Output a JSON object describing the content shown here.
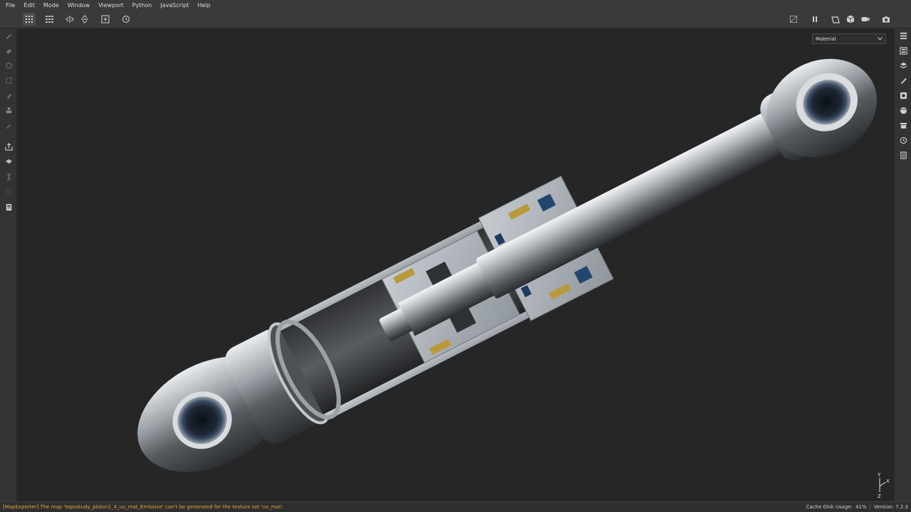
{
  "menu": [
    "File",
    "Edit",
    "Mode",
    "Window",
    "Viewport",
    "Python",
    "JavaScript",
    "Help"
  ],
  "viewport": {
    "display_mode": "Material"
  },
  "gizmo": {
    "y": "Y",
    "x": "X",
    "z": "Z"
  },
  "status": {
    "message": "[MapExporter] The map 'topostudy_piston1_4_uv_mat_Emissive' can't be generated for the texture set 'uv_mat'.",
    "cache_label": "Cache Disk Usage:",
    "cache_value": "41%",
    "separator": "|",
    "version": "Version: 7.2.3"
  },
  "colors": {
    "accent_status": "#e0a63a",
    "menubar_bg": "#3a3a3a",
    "viewport_bg": "#262626"
  },
  "icons": {
    "toolbar": [
      "grid-view-icon",
      "grid-layout-icon",
      "symmetry-x-icon",
      "symmetry-y-icon",
      "add-frame-icon",
      "history-icon",
      "hide-icon",
      "pause-icon",
      "frame-icon",
      "cube-icon",
      "camera-video-icon",
      "screenshot-icon"
    ],
    "left_tools": [
      "paint-brush-icon",
      "eraser-icon",
      "projection-icon",
      "geometry-mask-icon",
      "smudge-icon",
      "clone-stamp-icon",
      "color-picker-icon",
      "bake-icon",
      "polygon-fill-icon",
      "material-icon",
      "export-icon",
      "texture-icon"
    ],
    "right_panels": [
      "layers-panel-icon",
      "properties-panel-icon",
      "stack-icon",
      "brush-panel-icon",
      "display-settings-icon",
      "environment-icon",
      "shelf-icon",
      "history-panel-icon",
      "log-icon"
    ]
  }
}
